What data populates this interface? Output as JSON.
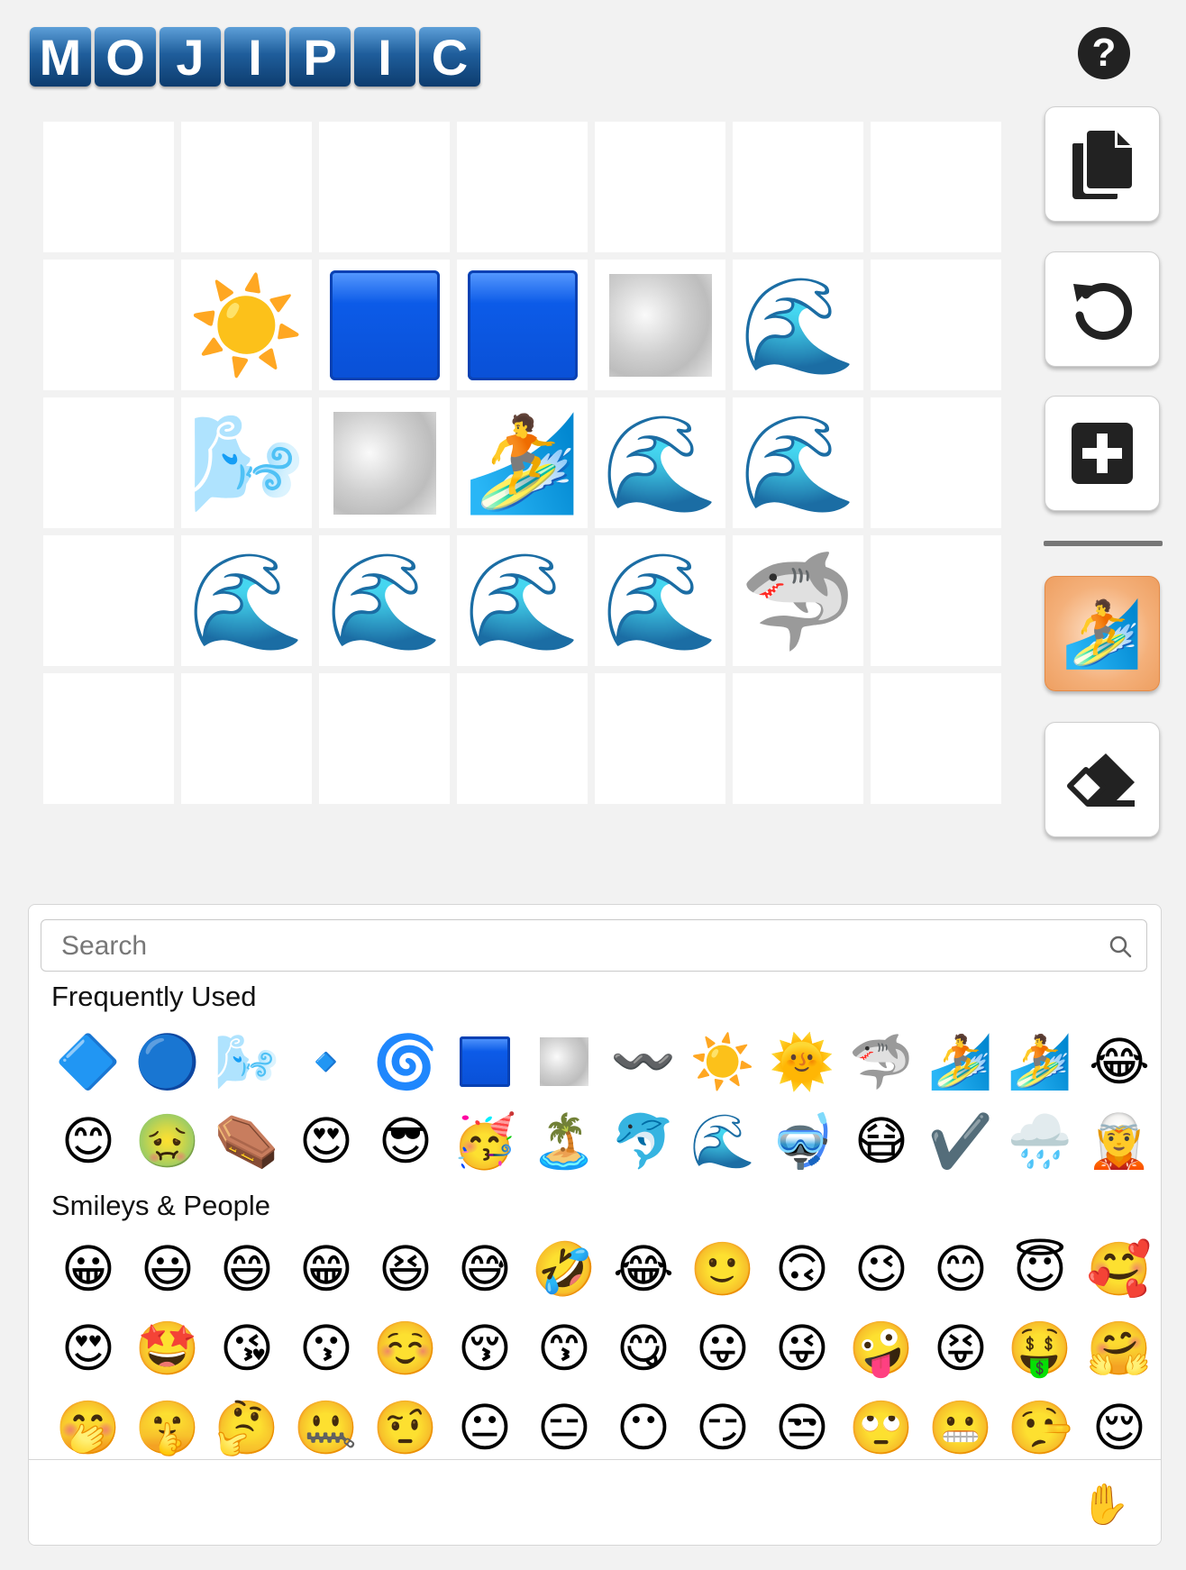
{
  "logo": {
    "letters": [
      "M",
      "O",
      "J",
      "I",
      "P",
      "I",
      "C"
    ]
  },
  "help": {
    "label": "?"
  },
  "grid": {
    "rows": [
      [
        "",
        "",
        "",
        "",
        "",
        "",
        ""
      ],
      [
        "",
        "☀️",
        "🟦",
        "🟦",
        "☁",
        "🌊",
        ""
      ],
      [
        "",
        "🌬️",
        "☁",
        "🏄",
        "🌊",
        "🌊",
        ""
      ],
      [
        "",
        "🌊",
        "🌊",
        "🌊",
        "🌊",
        "🦈",
        ""
      ],
      [
        "",
        "",
        "",
        "",
        "",
        "",
        ""
      ]
    ]
  },
  "toolbar": {
    "copy": "copy-icon",
    "undo": "undo-icon",
    "add": "add-icon",
    "selected_emoji": "🏄",
    "erase": "eraser-icon"
  },
  "picker": {
    "search_placeholder": "Search",
    "frequent_title": "Frequently Used",
    "frequent_row1": [
      "🔷",
      "🔵",
      "🌬️",
      "🔹",
      "🌀",
      "🟦",
      "☁",
      "〰️",
      "☀️",
      "🌞",
      "🦈",
      "🏄",
      "🏄",
      "😂"
    ],
    "frequent_row2": [
      "😊",
      "🤢",
      "⚰️",
      "😍",
      "😎",
      "🥳",
      "🏝️",
      "🐬",
      "🌊",
      "🤿",
      "😷",
      "✔️",
      "🌧️",
      "🧝"
    ],
    "smileys_title": "Smileys & People",
    "smileys_row1": [
      "😀",
      "😃",
      "😄",
      "😁",
      "😆",
      "😅",
      "🤣",
      "😂",
      "🙂",
      "🙃",
      "😉",
      "😊",
      "😇",
      "🥰"
    ],
    "smileys_row2": [
      "😍",
      "🤩",
      "😘",
      "😗",
      "☺️",
      "😚",
      "😙",
      "😋",
      "😛",
      "😜",
      "🤪",
      "😝",
      "🤑",
      "🤗"
    ],
    "smileys_row3": [
      "🤭",
      "🤫",
      "🤔",
      "🤐",
      "🤨",
      "😐",
      "😑",
      "😶",
      "😏",
      "😒",
      "🙄",
      "😬",
      "🤥",
      "😌"
    ],
    "skin_tone": "✋"
  }
}
